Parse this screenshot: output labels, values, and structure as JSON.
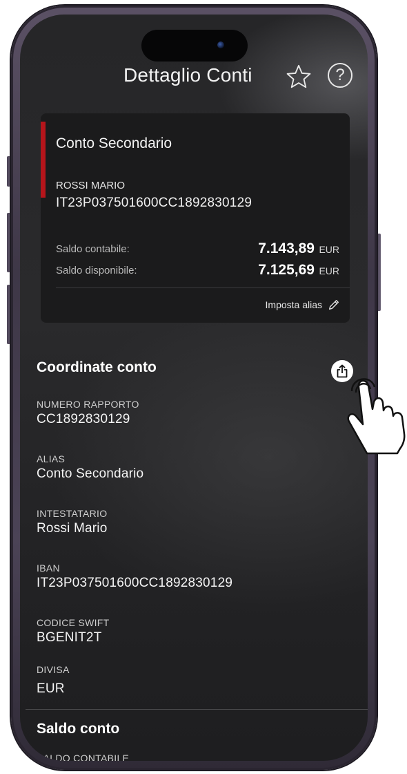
{
  "header": {
    "title": "Dettaglio Conti",
    "favorite_icon": "star-outline-icon",
    "help_label": "?"
  },
  "account_card": {
    "name": "Conto Secondario",
    "holder": "ROSSI MARIO",
    "iban": "IT23P037501600CC1892830129",
    "accent_color": "#b5151b",
    "balances": [
      {
        "label": "Saldo contabile:",
        "amount": "7.143,89",
        "currency": "EUR"
      },
      {
        "label": "Saldo disponibile:",
        "amount": "7.125,69",
        "currency": "EUR"
      }
    ],
    "alias_action": "Imposta alias",
    "alias_icon": "pencil-icon"
  },
  "coordinates": {
    "title": "Coordinate conto",
    "share_icon": "share-icon",
    "fields": [
      {
        "label": "NUMERO RAPPORTO",
        "value": "CC1892830129"
      },
      {
        "label": "ALIAS",
        "value": "Conto Secondario"
      },
      {
        "label": "INTESTATARIO",
        "value": "Rossi Mario"
      },
      {
        "label": "IBAN",
        "value": "IT23P037501600CC1892830129"
      },
      {
        "label": "CODICE SWIFT",
        "value": "BGENIT2T"
      },
      {
        "label": "DIVISA",
        "value": "EUR"
      }
    ]
  },
  "balance_section": {
    "title": "Saldo conto",
    "first_label": "SALDO CONTABILE"
  },
  "overlay": {
    "gesture_icon": "tap-hand-icon"
  }
}
